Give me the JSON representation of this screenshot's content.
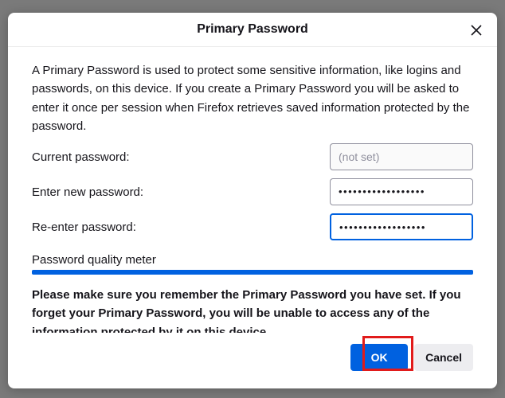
{
  "dialog": {
    "title": "Primary Password",
    "description": "A Primary Password is used to protect some sensitive information, like logins and passwords, on this device. If you create a Primary Password you will be asked to enter it once per session when Firefox retrieves saved information protected by the password.",
    "current_password_label": "Current password:",
    "current_password_placeholder": "(not set)",
    "enter_new_label": "Enter new password:",
    "enter_new_value": "••••••••••••••••••",
    "reenter_label": "Re-enter password:",
    "reenter_value": "••••••••••••••••••",
    "quality_label": "Password quality meter",
    "quality_percent": 100,
    "warning": "Please make sure you remember the Primary Password you have set. If you forget your Primary Password, you will be unable to access any of the information protected by it on this device.",
    "ok_label": "OK",
    "cancel_label": "Cancel"
  }
}
